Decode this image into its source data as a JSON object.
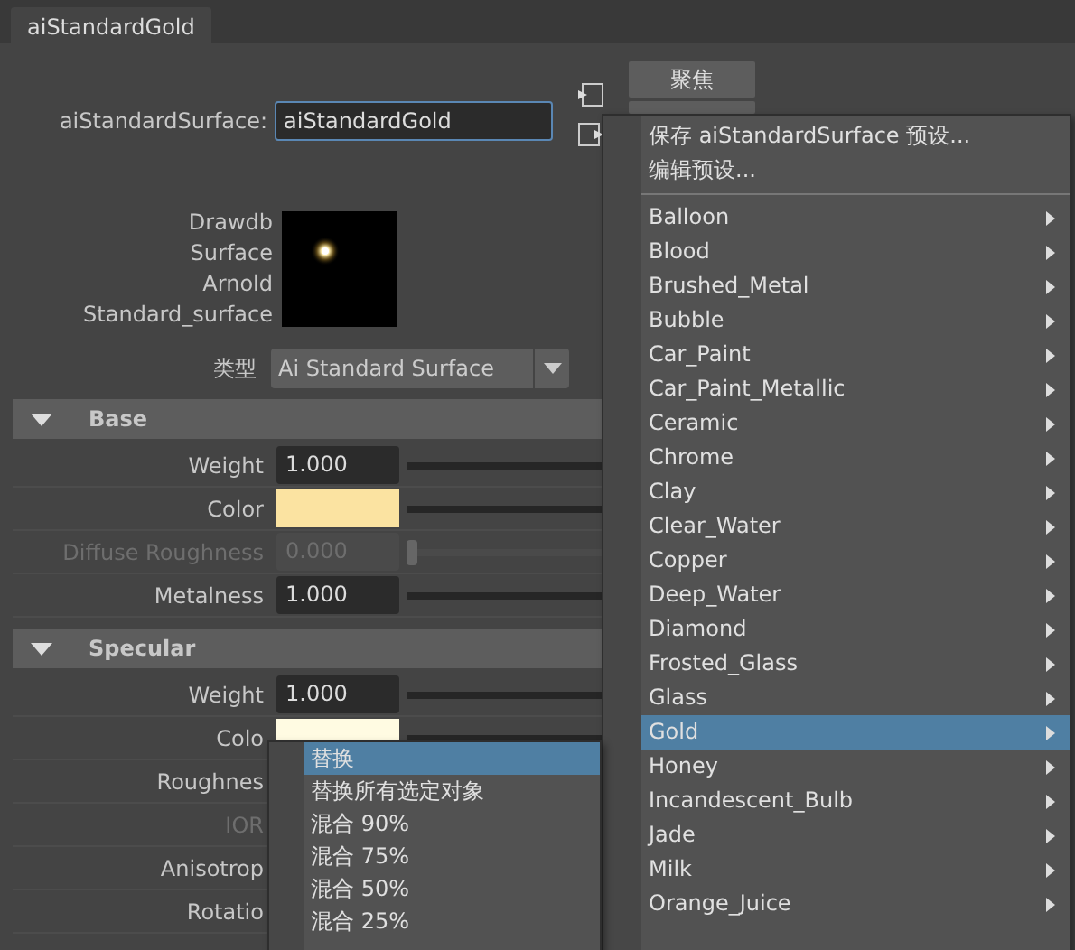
{
  "tab": {
    "label": "aiStandardGold",
    "selected": true
  },
  "node": {
    "label": "aiStandardSurface:",
    "value": "aiStandardGold"
  },
  "side_buttons": [
    {
      "label": "聚焦"
    }
  ],
  "swatch": {
    "labels": [
      "Drawdb",
      "Surface",
      "Arnold",
      "Standard_surface"
    ],
    "kind": "picture"
  },
  "type": {
    "label": "类型",
    "value": "Ai Standard Surface"
  },
  "sections": [
    {
      "title": "Base",
      "expanded": true,
      "attributes": [
        {
          "label": "Weight",
          "kind": "number",
          "value": "1.000",
          "disabled": false
        },
        {
          "label": "Color",
          "kind": "color",
          "color": "#fbe3a1",
          "disabled": false
        },
        {
          "label": "Diffuse Roughness",
          "kind": "number",
          "value": "0.000",
          "disabled": true,
          "level": 0
        },
        {
          "label": "Metalness",
          "kind": "number",
          "value": "1.000",
          "disabled": false
        }
      ]
    },
    {
      "title": "Specular",
      "expanded": true,
      "attributes": [
        {
          "label": "Weight",
          "kind": "number",
          "value": "1.000",
          "disabled": false
        },
        {
          "label": "Colo",
          "kind": "color",
          "color": "#fffbe2",
          "disabled": false
        },
        {
          "label": "Roughnes",
          "kind": "covered",
          "disabled": false
        },
        {
          "label": "IOR",
          "kind": "covered",
          "disabled": true
        },
        {
          "label": "Anisotrop",
          "kind": "covered",
          "disabled": false
        },
        {
          "label": "Rotatio",
          "kind": "covered",
          "disabled": false
        }
      ]
    }
  ],
  "preset_menu": {
    "actions": [
      "保存 aiStandardSurface 预设...",
      "编辑预设..."
    ],
    "presets": [
      {
        "label": "Balloon",
        "selected": false
      },
      {
        "label": "Blood",
        "selected": false
      },
      {
        "label": "Brushed_Metal",
        "selected": false
      },
      {
        "label": "Bubble",
        "selected": false
      },
      {
        "label": "Car_Paint",
        "selected": false
      },
      {
        "label": "Car_Paint_Metallic",
        "selected": false
      },
      {
        "label": "Ceramic",
        "selected": false
      },
      {
        "label": "Chrome",
        "selected": false
      },
      {
        "label": "Clay",
        "selected": false
      },
      {
        "label": "Clear_Water",
        "selected": false
      },
      {
        "label": "Copper",
        "selected": false
      },
      {
        "label": "Deep_Water",
        "selected": false
      },
      {
        "label": "Diamond",
        "selected": false
      },
      {
        "label": "Frosted_Glass",
        "selected": false
      },
      {
        "label": "Glass",
        "selected": false
      },
      {
        "label": "Gold",
        "selected": true
      },
      {
        "label": "Honey",
        "selected": false
      },
      {
        "label": "Incandescent_Bulb",
        "selected": false
      },
      {
        "label": "Jade",
        "selected": false
      },
      {
        "label": "Milk",
        "selected": false
      },
      {
        "label": "Orange_Juice",
        "selected": false
      }
    ]
  },
  "blend_menu": [
    {
      "label": "替换",
      "selected": true
    },
    {
      "label": "替换所有选定对象",
      "selected": false
    },
    {
      "label": "混合 90%",
      "selected": false
    },
    {
      "label": "混合 75%",
      "selected": false
    },
    {
      "label": "混合 50%",
      "selected": false
    },
    {
      "label": "混合 25%",
      "selected": false
    }
  ]
}
